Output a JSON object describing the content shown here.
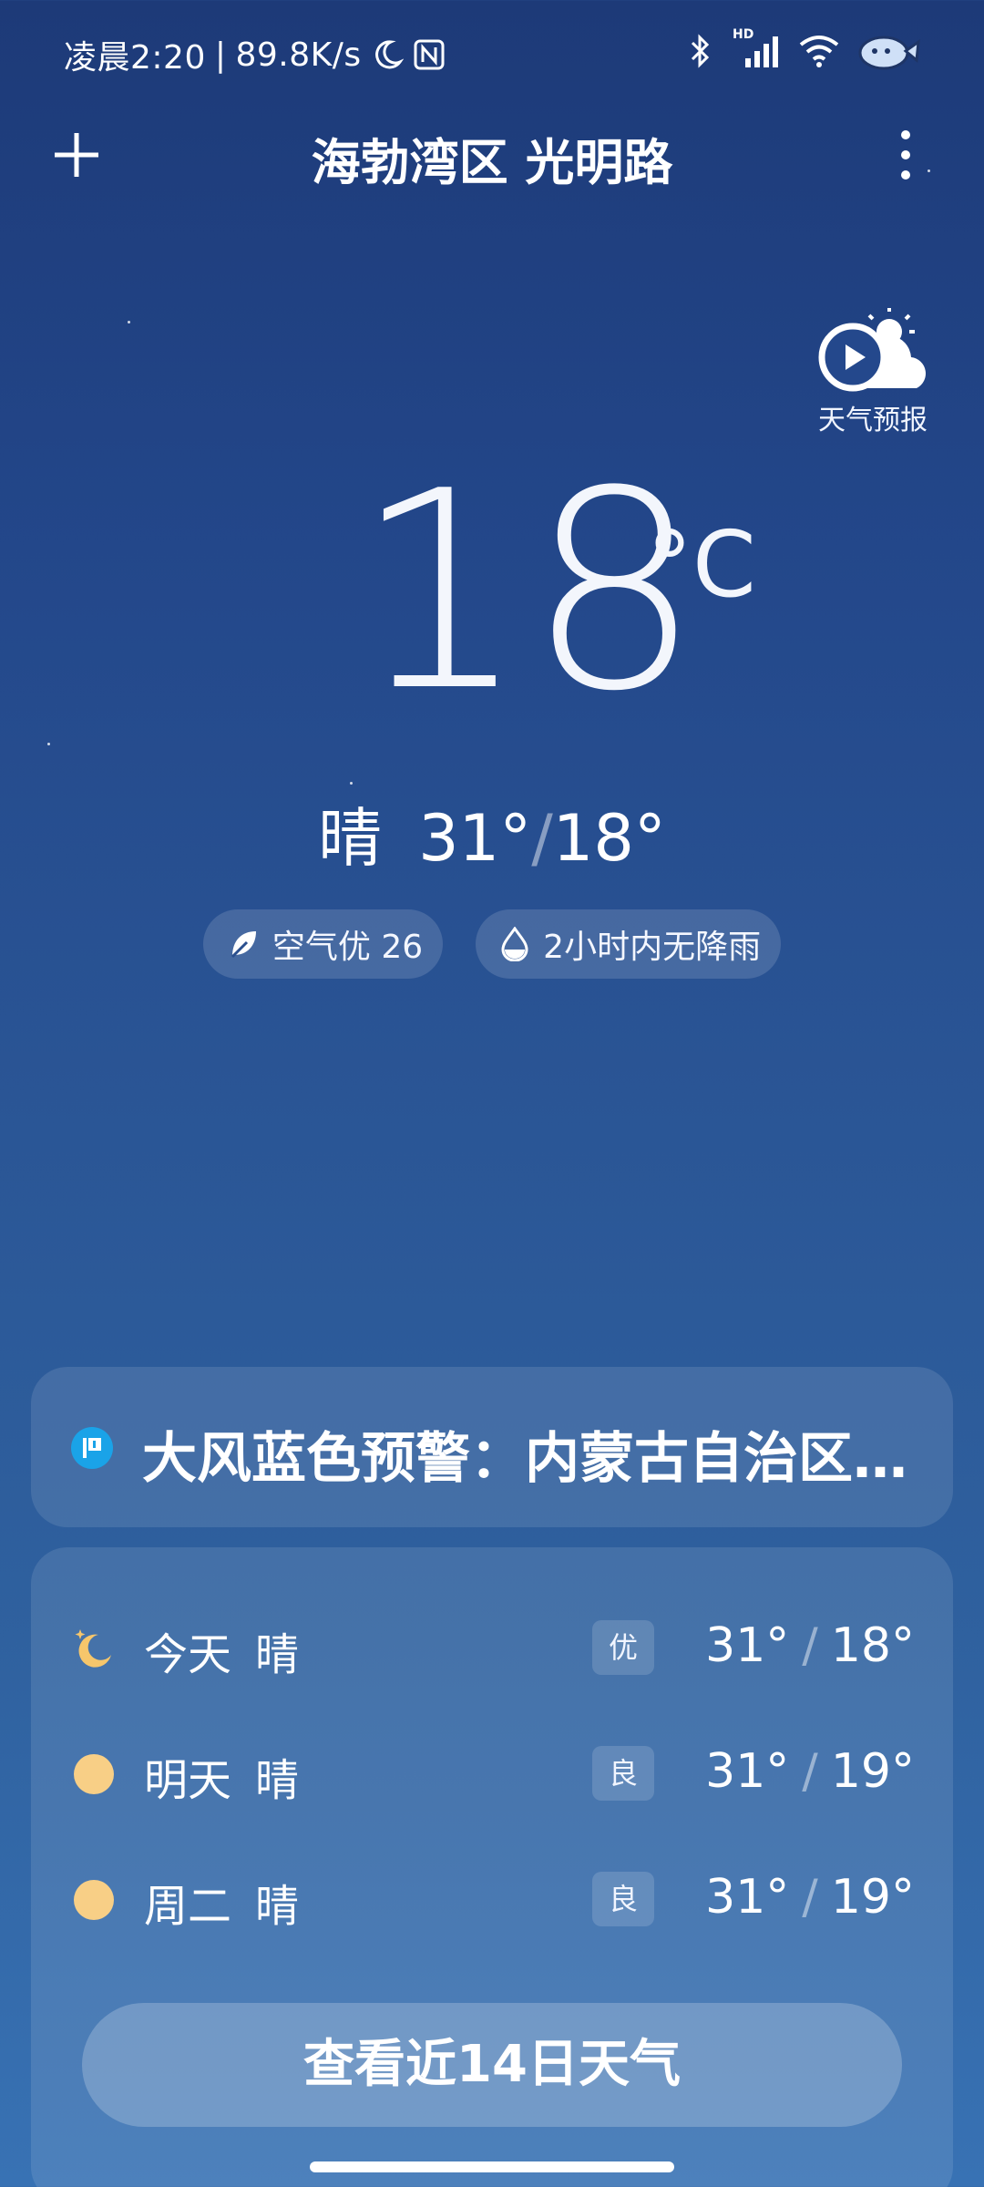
{
  "status_bar": {
    "time": "凌晨2:20",
    "separator": "|",
    "network_speed": "89.8K/s",
    "icons": [
      "moon-icon",
      "nfc-icon",
      "bluetooth-icon",
      "hd-signal-icon",
      "wifi-icon",
      "mascot-icon"
    ],
    "hd_label": "HD"
  },
  "header": {
    "location": "海勃湾区 光明路",
    "add_icon": "plus-icon",
    "menu_icon": "more-vertical-icon"
  },
  "forecast_video": {
    "label": "天气预报",
    "icon": "play-weather-icon"
  },
  "current": {
    "temperature": "18",
    "unit": "°C",
    "condition": "晴",
    "high": "31°",
    "slash": "/",
    "low": "18°"
  },
  "pills": [
    {
      "icon": "leaf-icon",
      "label": "空气优 26"
    },
    {
      "icon": "raindrop-icon",
      "label": "2小时内无降雨"
    }
  ],
  "alert": {
    "icon": "warning-flag-icon",
    "text": "大风蓝色预警：内蒙古自治区…",
    "color": "#1aa3e8"
  },
  "daily": [
    {
      "icon": "moon-star-icon",
      "day": "今天",
      "condition": "晴",
      "aqi": "优",
      "high": "31°",
      "low": "18°"
    },
    {
      "icon": "sun-icon",
      "day": "明天",
      "condition": "晴",
      "aqi": "良",
      "high": "31°",
      "low": "19°"
    },
    {
      "icon": "sun-icon",
      "day": "周二",
      "condition": "晴",
      "aqi": "良",
      "high": "31°",
      "low": "19°"
    }
  ],
  "more_button": {
    "label": "查看近14日天气"
  },
  "colors": {
    "sun": "#f8cf86",
    "moon": "#f6c66b",
    "background_top": "#1d3a78",
    "background_bottom": "#3872b4"
  }
}
